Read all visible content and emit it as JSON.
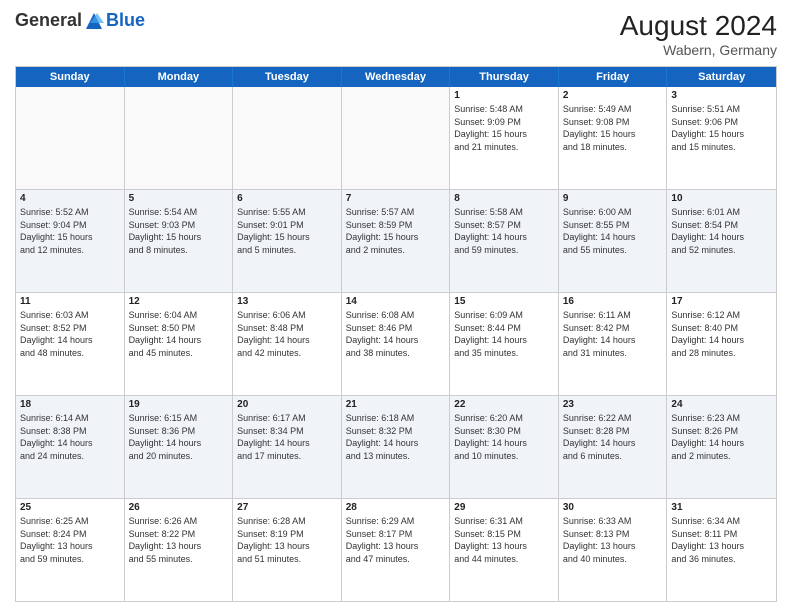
{
  "header": {
    "logo_general": "General",
    "logo_blue": "Blue",
    "month_year": "August 2024",
    "location": "Wabern, Germany"
  },
  "weekdays": [
    "Sunday",
    "Monday",
    "Tuesday",
    "Wednesday",
    "Thursday",
    "Friday",
    "Saturday"
  ],
  "rows": [
    {
      "alt": false,
      "cells": [
        {
          "day": "",
          "info": ""
        },
        {
          "day": "",
          "info": ""
        },
        {
          "day": "",
          "info": ""
        },
        {
          "day": "",
          "info": ""
        },
        {
          "day": "1",
          "info": "Sunrise: 5:48 AM\nSunset: 9:09 PM\nDaylight: 15 hours\nand 21 minutes."
        },
        {
          "day": "2",
          "info": "Sunrise: 5:49 AM\nSunset: 9:08 PM\nDaylight: 15 hours\nand 18 minutes."
        },
        {
          "day": "3",
          "info": "Sunrise: 5:51 AM\nSunset: 9:06 PM\nDaylight: 15 hours\nand 15 minutes."
        }
      ]
    },
    {
      "alt": true,
      "cells": [
        {
          "day": "4",
          "info": "Sunrise: 5:52 AM\nSunset: 9:04 PM\nDaylight: 15 hours\nand 12 minutes."
        },
        {
          "day": "5",
          "info": "Sunrise: 5:54 AM\nSunset: 9:03 PM\nDaylight: 15 hours\nand 8 minutes."
        },
        {
          "day": "6",
          "info": "Sunrise: 5:55 AM\nSunset: 9:01 PM\nDaylight: 15 hours\nand 5 minutes."
        },
        {
          "day": "7",
          "info": "Sunrise: 5:57 AM\nSunset: 8:59 PM\nDaylight: 15 hours\nand 2 minutes."
        },
        {
          "day": "8",
          "info": "Sunrise: 5:58 AM\nSunset: 8:57 PM\nDaylight: 14 hours\nand 59 minutes."
        },
        {
          "day": "9",
          "info": "Sunrise: 6:00 AM\nSunset: 8:55 PM\nDaylight: 14 hours\nand 55 minutes."
        },
        {
          "day": "10",
          "info": "Sunrise: 6:01 AM\nSunset: 8:54 PM\nDaylight: 14 hours\nand 52 minutes."
        }
      ]
    },
    {
      "alt": false,
      "cells": [
        {
          "day": "11",
          "info": "Sunrise: 6:03 AM\nSunset: 8:52 PM\nDaylight: 14 hours\nand 48 minutes."
        },
        {
          "day": "12",
          "info": "Sunrise: 6:04 AM\nSunset: 8:50 PM\nDaylight: 14 hours\nand 45 minutes."
        },
        {
          "day": "13",
          "info": "Sunrise: 6:06 AM\nSunset: 8:48 PM\nDaylight: 14 hours\nand 42 minutes."
        },
        {
          "day": "14",
          "info": "Sunrise: 6:08 AM\nSunset: 8:46 PM\nDaylight: 14 hours\nand 38 minutes."
        },
        {
          "day": "15",
          "info": "Sunrise: 6:09 AM\nSunset: 8:44 PM\nDaylight: 14 hours\nand 35 minutes."
        },
        {
          "day": "16",
          "info": "Sunrise: 6:11 AM\nSunset: 8:42 PM\nDaylight: 14 hours\nand 31 minutes."
        },
        {
          "day": "17",
          "info": "Sunrise: 6:12 AM\nSunset: 8:40 PM\nDaylight: 14 hours\nand 28 minutes."
        }
      ]
    },
    {
      "alt": true,
      "cells": [
        {
          "day": "18",
          "info": "Sunrise: 6:14 AM\nSunset: 8:38 PM\nDaylight: 14 hours\nand 24 minutes."
        },
        {
          "day": "19",
          "info": "Sunrise: 6:15 AM\nSunset: 8:36 PM\nDaylight: 14 hours\nand 20 minutes."
        },
        {
          "day": "20",
          "info": "Sunrise: 6:17 AM\nSunset: 8:34 PM\nDaylight: 14 hours\nand 17 minutes."
        },
        {
          "day": "21",
          "info": "Sunrise: 6:18 AM\nSunset: 8:32 PM\nDaylight: 14 hours\nand 13 minutes."
        },
        {
          "day": "22",
          "info": "Sunrise: 6:20 AM\nSunset: 8:30 PM\nDaylight: 14 hours\nand 10 minutes."
        },
        {
          "day": "23",
          "info": "Sunrise: 6:22 AM\nSunset: 8:28 PM\nDaylight: 14 hours\nand 6 minutes."
        },
        {
          "day": "24",
          "info": "Sunrise: 6:23 AM\nSunset: 8:26 PM\nDaylight: 14 hours\nand 2 minutes."
        }
      ]
    },
    {
      "alt": false,
      "cells": [
        {
          "day": "25",
          "info": "Sunrise: 6:25 AM\nSunset: 8:24 PM\nDaylight: 13 hours\nand 59 minutes."
        },
        {
          "day": "26",
          "info": "Sunrise: 6:26 AM\nSunset: 8:22 PM\nDaylight: 13 hours\nand 55 minutes."
        },
        {
          "day": "27",
          "info": "Sunrise: 6:28 AM\nSunset: 8:19 PM\nDaylight: 13 hours\nand 51 minutes."
        },
        {
          "day": "28",
          "info": "Sunrise: 6:29 AM\nSunset: 8:17 PM\nDaylight: 13 hours\nand 47 minutes."
        },
        {
          "day": "29",
          "info": "Sunrise: 6:31 AM\nSunset: 8:15 PM\nDaylight: 13 hours\nand 44 minutes."
        },
        {
          "day": "30",
          "info": "Sunrise: 6:33 AM\nSunset: 8:13 PM\nDaylight: 13 hours\nand 40 minutes."
        },
        {
          "day": "31",
          "info": "Sunrise: 6:34 AM\nSunset: 8:11 PM\nDaylight: 13 hours\nand 36 minutes."
        }
      ]
    }
  ]
}
